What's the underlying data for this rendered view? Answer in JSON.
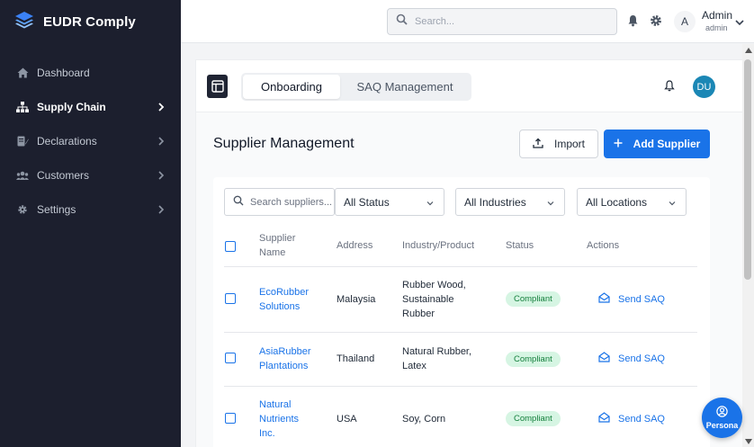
{
  "brand": {
    "name": "EUDR Comply",
    "icon": "layers-icon"
  },
  "sidebar": {
    "items": [
      {
        "label": "Dashboard",
        "icon": "home-icon",
        "active": false,
        "has_chevron": false
      },
      {
        "label": "Supply Chain",
        "icon": "org-chart-icon",
        "active": true,
        "has_chevron": true
      },
      {
        "label": "Declarations",
        "icon": "document-icon",
        "active": false,
        "has_chevron": true
      },
      {
        "label": "Customers",
        "icon": "users-icon",
        "active": false,
        "has_chevron": true
      },
      {
        "label": "Settings",
        "icon": "gear-icon",
        "active": false,
        "has_chevron": true
      }
    ]
  },
  "topbar": {
    "search_placeholder": "Search...",
    "avatar_initial": "A",
    "user_name": "Admin",
    "user_role": "admin"
  },
  "card": {
    "tabs": [
      {
        "label": "Onboarding",
        "active": true
      },
      {
        "label": "SAQ Management",
        "active": false
      }
    ],
    "avatar_initials": "DU",
    "avatar_color": "#1b87b5"
  },
  "section": {
    "title": "Supplier Management",
    "import_label": "Import",
    "add_label": "Add Supplier"
  },
  "filters": {
    "search_placeholder": "Search suppliers...",
    "status": "All Status",
    "industries": "All Industries",
    "locations": "All Locations"
  },
  "table": {
    "headers": {
      "name_line1": "Supplier",
      "name_line2": "Name",
      "address": "Address",
      "industry": "Industry/Product",
      "status": "Status",
      "actions": "Actions"
    },
    "rows": [
      {
        "name": [
          "EcoRubber",
          "Solutions"
        ],
        "address": "Malaysia",
        "industry": [
          "Rubber Wood,",
          "Sustainable",
          "Rubber"
        ],
        "status": "Compliant",
        "action": "Send SAQ"
      },
      {
        "name": [
          "AsiaRubber",
          "Plantations"
        ],
        "address": "Thailand",
        "industry": [
          "Natural Rubber,",
          "Latex"
        ],
        "status": "Compliant",
        "action": "Send SAQ"
      },
      {
        "name": [
          "Natural",
          "Nutrients",
          "Inc."
        ],
        "address": "USA",
        "industry": [
          "Soy, Corn"
        ],
        "status": "Compliant",
        "action": "Send SAQ"
      }
    ]
  },
  "persona": {
    "label": "Persona"
  },
  "colors": {
    "accent": "#1a73e8",
    "sidebar_bg": "#1c1f2e",
    "compliant_bg": "#d6f5e3",
    "compliant_text": "#15803d"
  }
}
